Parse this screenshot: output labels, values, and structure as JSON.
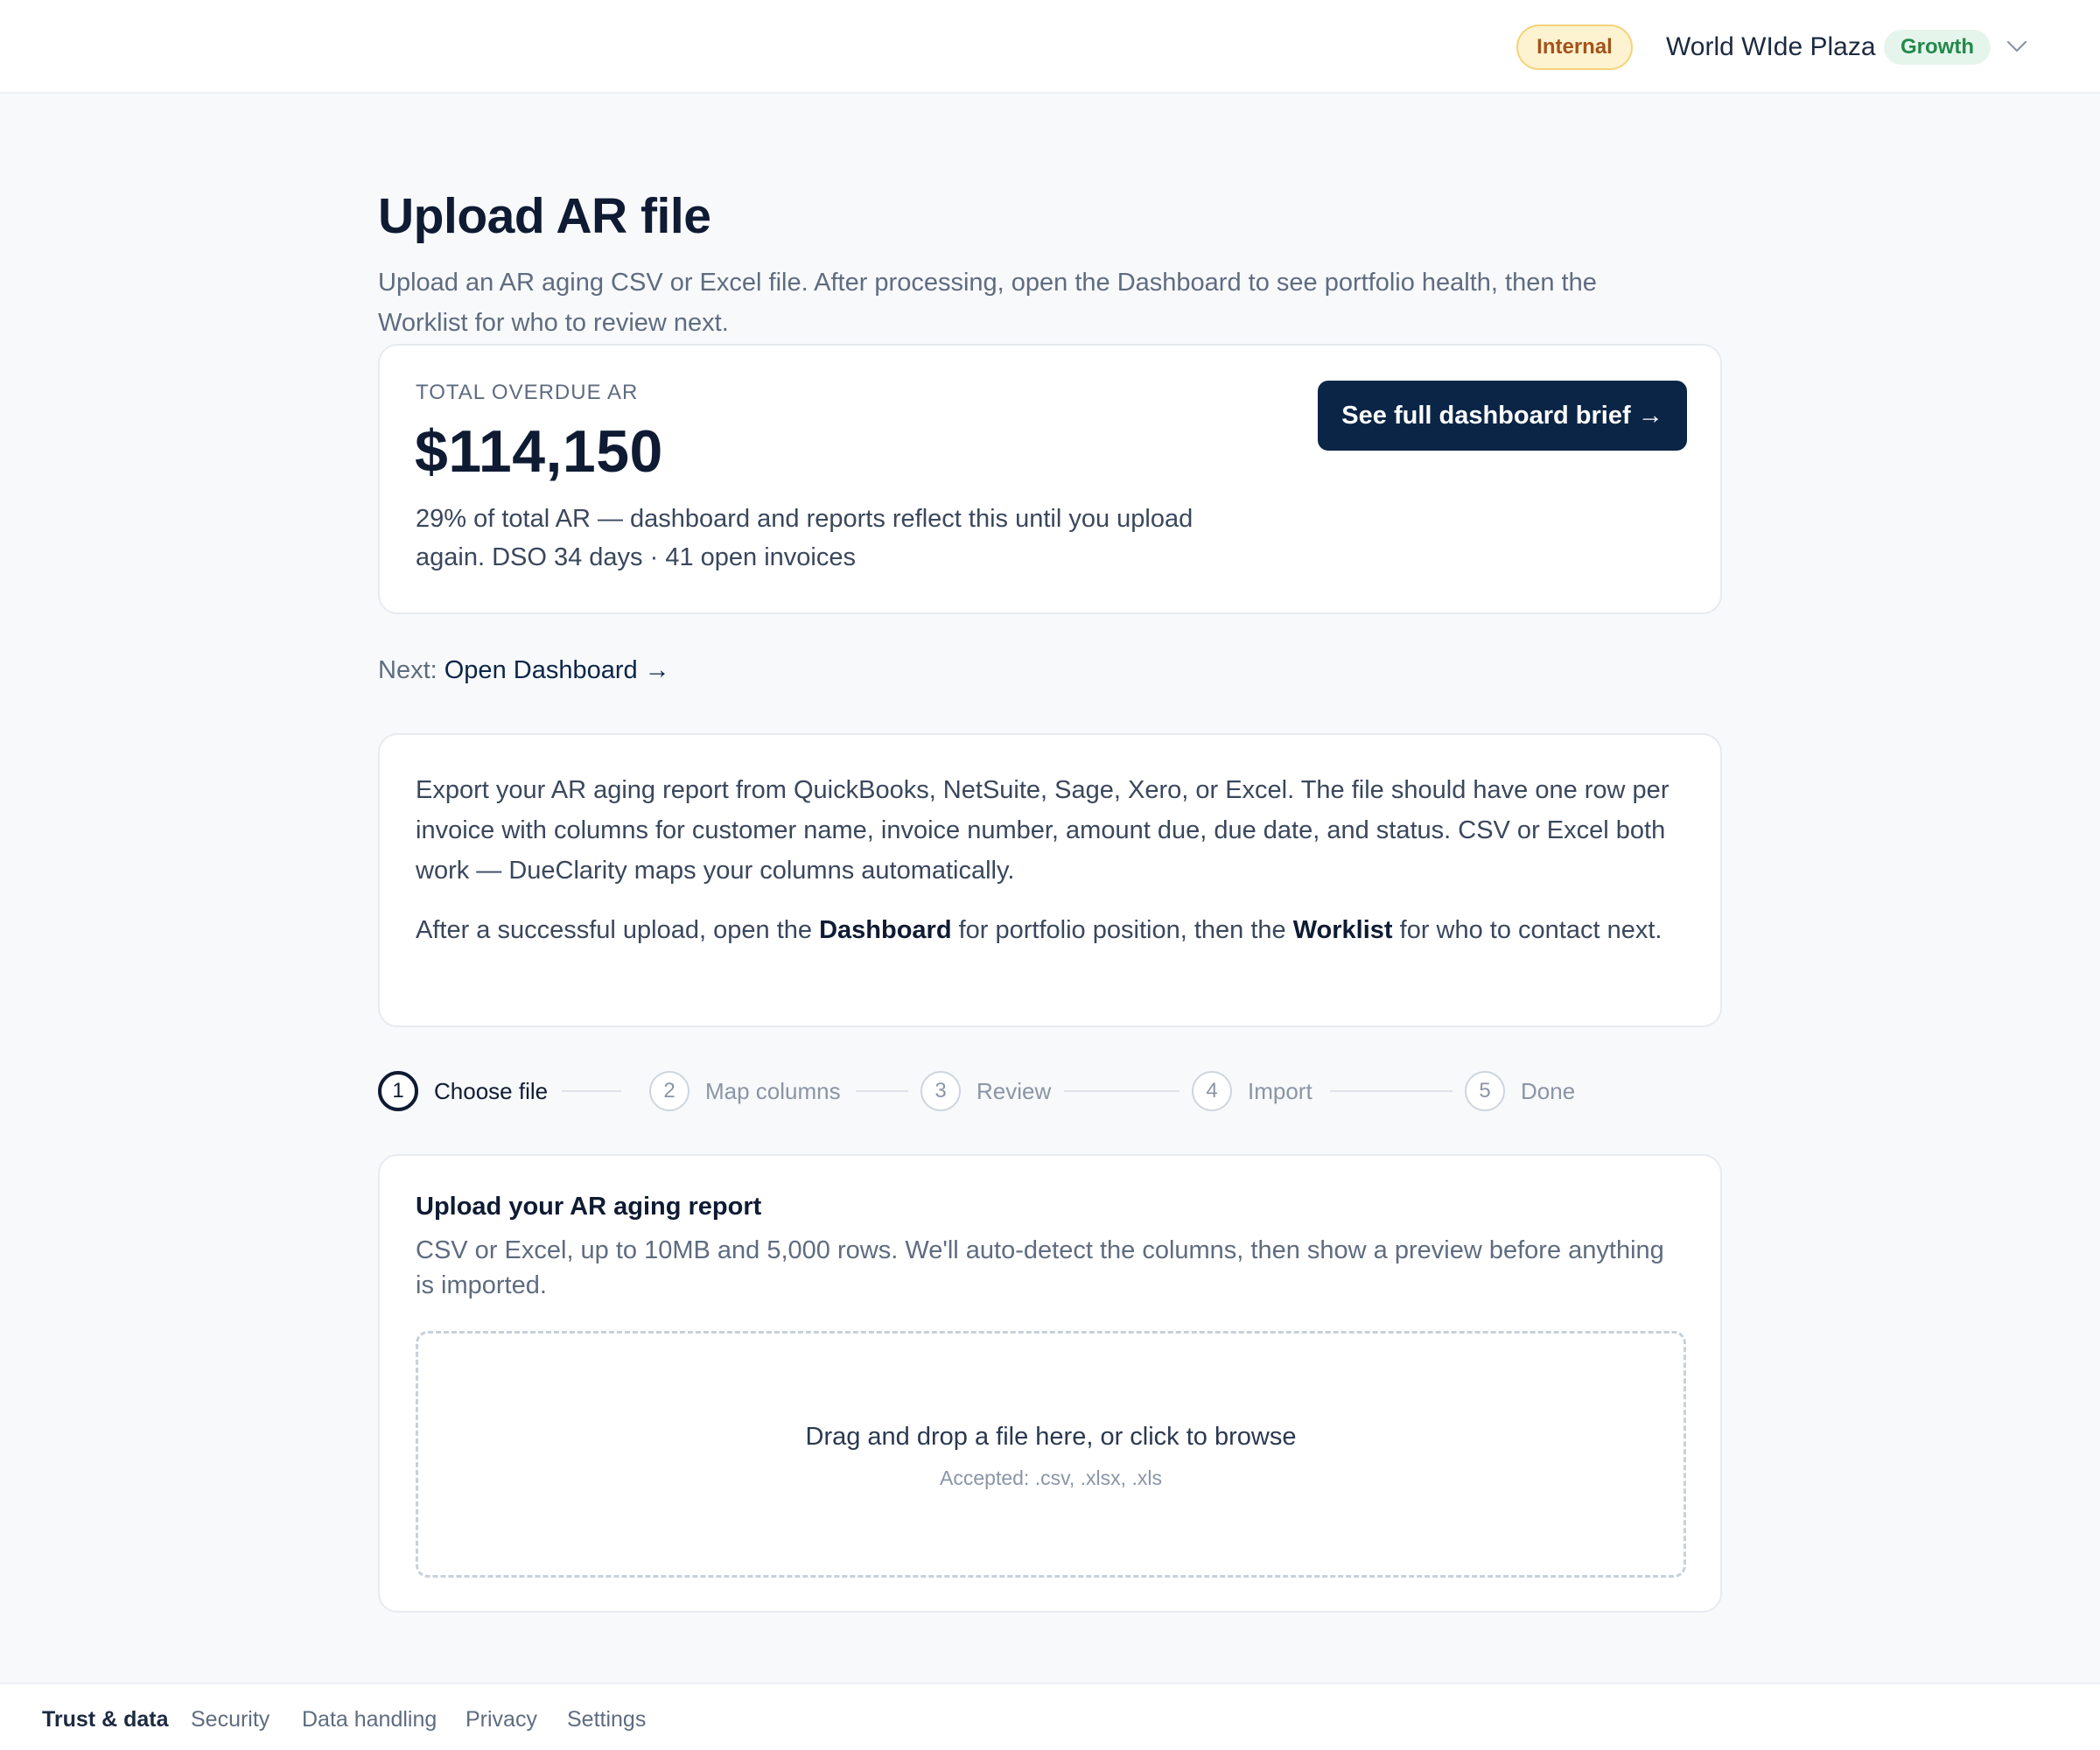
{
  "header": {
    "environment_badge": "Internal",
    "org_name": "World WIde Plaza",
    "plan_badge": "Growth",
    "icons": {
      "org_menu": "chevron-down-icon"
    }
  },
  "page": {
    "title": "Upload AR file",
    "subtitle": "Upload an AR aging CSV or Excel file. After processing, open the Dashboard to see portfolio health, then the Worklist for who to review next."
  },
  "summary": {
    "label": "TOTAL OVERDUE AR",
    "amount": "$114,150",
    "description": "29% of total AR — dashboard and reports reflect this until you upload again. DSO 34 days · 41 open invoices",
    "button_label": "See full dashboard brief →"
  },
  "next": {
    "prefix": "Next:",
    "link_label": "Open Dashboard →"
  },
  "info": {
    "paragraph1": "Export your AR aging report from QuickBooks, NetSuite, Sage, Xero, or Excel. The file should have one row per invoice with columns for customer name, invoice number, amount due, due date, and status. CSV or Excel both work — DueClarity maps your columns automatically.",
    "p2_before": "After a successful upload, open the ",
    "p2_dashboard": "Dashboard",
    "p2_middle": " for portfolio position, then the ",
    "p2_worklist": "Worklist",
    "p2_after": " for who to contact next."
  },
  "stepper": {
    "current_step": 1,
    "steps": [
      {
        "number": "1",
        "label": "Choose file"
      },
      {
        "number": "2",
        "label": "Map columns"
      },
      {
        "number": "3",
        "label": "Review"
      },
      {
        "number": "4",
        "label": "Import"
      },
      {
        "number": "5",
        "label": "Done"
      }
    ]
  },
  "upload": {
    "title": "Upload your AR aging report",
    "description": "CSV or Excel, up to 10MB and 5,000 rows. We'll auto-detect the columns, then show a preview before anything is imported.",
    "dropzone_text": "Drag and drop a file here, or click to browse",
    "accepted": "Accepted: .csv, .xlsx, .xls"
  },
  "footer": {
    "title": "Trust & data",
    "links": [
      "Security",
      "Data handling",
      "Privacy",
      "Settings"
    ]
  },
  "colors": {
    "primary": "#0b2547",
    "heading": "#0f1b33",
    "muted": "#5f6c80",
    "internal_badge_bg": "#fdf3d0",
    "internal_badge_text": "#a4531a",
    "growth_badge_bg": "#e6f5ec",
    "growth_badge_text": "#23894b",
    "page_bg": "#f8f9fb"
  }
}
